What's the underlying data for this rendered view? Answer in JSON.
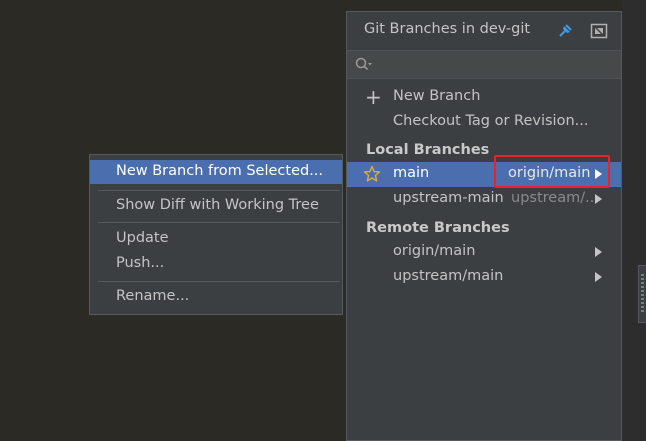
{
  "popup": {
    "title": "Git Branches in dev-git",
    "header_icons": [
      "pin-icon",
      "expand-icon"
    ],
    "search": {
      "value": "",
      "placeholder": ""
    },
    "actions": [
      {
        "label": "New Branch",
        "icon": "plus-icon"
      },
      {
        "label": "Checkout Tag or Revision..."
      }
    ],
    "local_section": "Local Branches",
    "local_branches": [
      {
        "name": "main",
        "tracking": "origin/main",
        "favorite": true,
        "selected": true
      },
      {
        "name": "upstream-main",
        "tracking": "upstream/...",
        "favorite": false,
        "selected": false
      }
    ],
    "remote_section": "Remote Branches",
    "remote_branches": [
      {
        "name": "origin/main"
      },
      {
        "name": "upstream/main"
      }
    ]
  },
  "context_menu": {
    "items": [
      {
        "label": "New Branch from Selected...",
        "selected": true
      },
      {
        "label": "Show Diff with Working Tree"
      },
      {
        "label": "Update"
      },
      {
        "label": "Push..."
      },
      {
        "label": "Rename..."
      }
    ]
  },
  "colors": {
    "selection": "#4b6eaf",
    "popup_bg": "#3c3f41",
    "highlight_box": "#e8242a",
    "star": "#e2a83b",
    "pin_icon": "#3f9be0"
  }
}
